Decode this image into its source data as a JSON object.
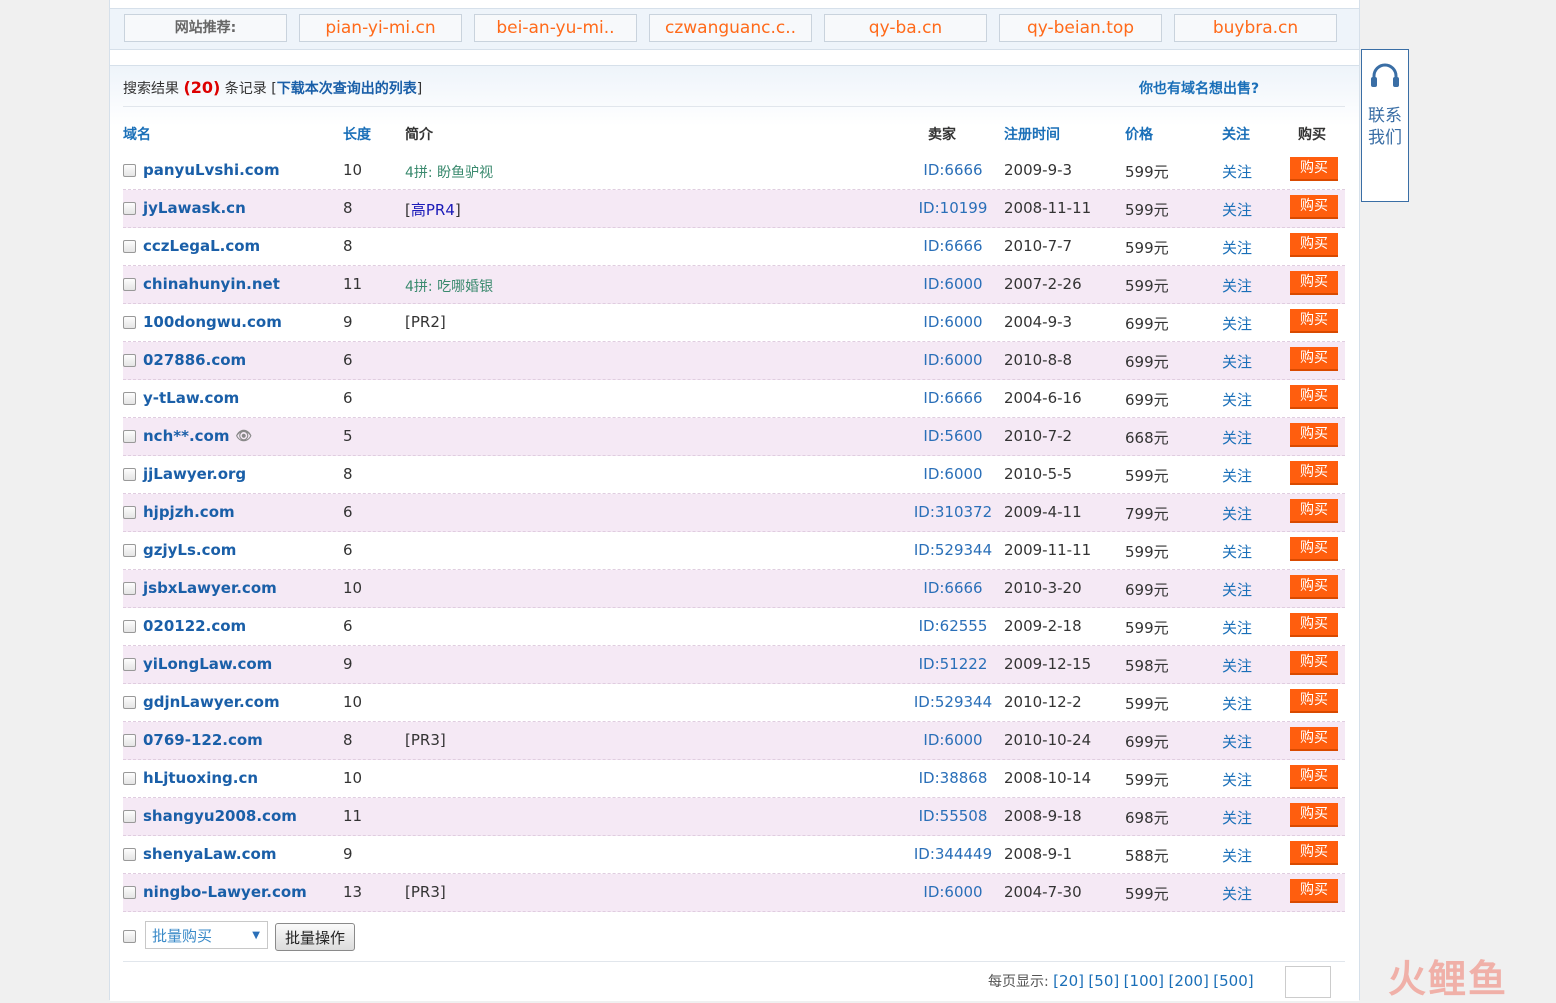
{
  "recommend": {
    "label": "网站推荐:",
    "sites": [
      "pian-yi-mi.cn",
      "bei-an-yu-mi..",
      "czwanguanc.c..",
      "qy-ba.cn",
      "qy-beian.top",
      "buybra.cn"
    ]
  },
  "summary": {
    "prefix": "搜索结果",
    "count": "(20)",
    "suffix": "条记录 [",
    "download": "下载本次查询出的列表",
    "close": "]",
    "sell_question": "你也有域名想出售?"
  },
  "headers": {
    "domain": "域名",
    "length": "长度",
    "intro": "简介",
    "seller": "卖家",
    "regdate": "注册时间",
    "price": "价格",
    "follow": "关注",
    "buy": "购买"
  },
  "rows": [
    {
      "domain": "panyuLvshi.com",
      "length": "10",
      "intro": "4拼: 盼鱼驴视",
      "intro_type": "pinyin",
      "seller": "ID:6666",
      "date": "2009-9-3",
      "price": "599元"
    },
    {
      "domain": "jyLawask.cn",
      "length": "8",
      "intro": "[高PR4]",
      "intro_type": "pr_high",
      "seller": "ID:10199",
      "date": "2008-11-11",
      "price": "599元"
    },
    {
      "domain": "cczLegaL.com",
      "length": "8",
      "intro": "",
      "intro_type": "",
      "seller": "ID:6666",
      "date": "2010-7-7",
      "price": "599元"
    },
    {
      "domain": "chinahunyin.net",
      "length": "11",
      "intro": "4拼: 吃哪婚银",
      "intro_type": "pinyin",
      "seller": "ID:6000",
      "date": "2007-2-26",
      "price": "599元"
    },
    {
      "domain": "100dongwu.com",
      "length": "9",
      "intro": "[PR2]",
      "intro_type": "pr",
      "seller": "ID:6000",
      "date": "2004-9-3",
      "price": "699元"
    },
    {
      "domain": "027886.com",
      "length": "6",
      "intro": "",
      "intro_type": "",
      "seller": "ID:6000",
      "date": "2010-8-8",
      "price": "699元"
    },
    {
      "domain": "y-tLaw.com",
      "length": "6",
      "intro": "",
      "intro_type": "",
      "seller": "ID:6666",
      "date": "2004-6-16",
      "price": "699元"
    },
    {
      "domain": "nch**.com",
      "length": "5",
      "intro": "",
      "intro_type": "",
      "seller": "ID:5600",
      "date": "2010-7-2",
      "price": "668元",
      "hidden": true
    },
    {
      "domain": "jjLawyer.org",
      "length": "8",
      "intro": "",
      "intro_type": "",
      "seller": "ID:6000",
      "date": "2010-5-5",
      "price": "599元"
    },
    {
      "domain": "hjpjzh.com",
      "length": "6",
      "intro": "",
      "intro_type": "",
      "seller": "ID:310372",
      "date": "2009-4-11",
      "price": "799元"
    },
    {
      "domain": "gzjyLs.com",
      "length": "6",
      "intro": "",
      "intro_type": "",
      "seller": "ID:529344",
      "date": "2009-11-11",
      "price": "599元"
    },
    {
      "domain": "jsbxLawyer.com",
      "length": "10",
      "intro": "",
      "intro_type": "",
      "seller": "ID:6666",
      "date": "2010-3-20",
      "price": "699元"
    },
    {
      "domain": "020122.com",
      "length": "6",
      "intro": "",
      "intro_type": "",
      "seller": "ID:62555",
      "date": "2009-2-18",
      "price": "599元"
    },
    {
      "domain": "yiLongLaw.com",
      "length": "9",
      "intro": "",
      "intro_type": "",
      "seller": "ID:51222",
      "date": "2009-12-15",
      "price": "598元"
    },
    {
      "domain": "gdjnLawyer.com",
      "length": "10",
      "intro": "",
      "intro_type": "",
      "seller": "ID:529344",
      "date": "2010-12-2",
      "price": "599元"
    },
    {
      "domain": "0769-122.com",
      "length": "8",
      "intro": "[PR3]",
      "intro_type": "pr",
      "seller": "ID:6000",
      "date": "2010-10-24",
      "price": "699元"
    },
    {
      "domain": "hLjtuoxing.cn",
      "length": "10",
      "intro": "",
      "intro_type": "",
      "seller": "ID:38868",
      "date": "2008-10-14",
      "price": "599元"
    },
    {
      "domain": "shangyu2008.com",
      "length": "11",
      "intro": "",
      "intro_type": "",
      "seller": "ID:55508",
      "date": "2008-9-18",
      "price": "698元"
    },
    {
      "domain": "shenyaLaw.com",
      "length": "9",
      "intro": "",
      "intro_type": "",
      "seller": "ID:344449",
      "date": "2008-9-1",
      "price": "588元"
    },
    {
      "domain": "ningbo-Lawyer.com",
      "length": "13",
      "intro": "[PR3]",
      "intro_type": "pr",
      "seller": "ID:6000",
      "date": "2004-7-30",
      "price": "599元"
    }
  ],
  "row_labels": {
    "follow": "关注",
    "buy": "购买"
  },
  "batch": {
    "select_value": "批量购买",
    "button": "批量操作"
  },
  "pager": {
    "label": "每页显示:",
    "options": [
      "[20]",
      "[50]",
      "[100]",
      "[200]",
      "[500]"
    ]
  },
  "contact": {
    "label": "联系我们"
  },
  "watermark": "火鲤鱼",
  "colors": {
    "link": "#1a5fa8",
    "buy_button": "#ff5e0e",
    "alt_row": "#f5e9f5",
    "recommend_site": "#ff6a1a"
  }
}
